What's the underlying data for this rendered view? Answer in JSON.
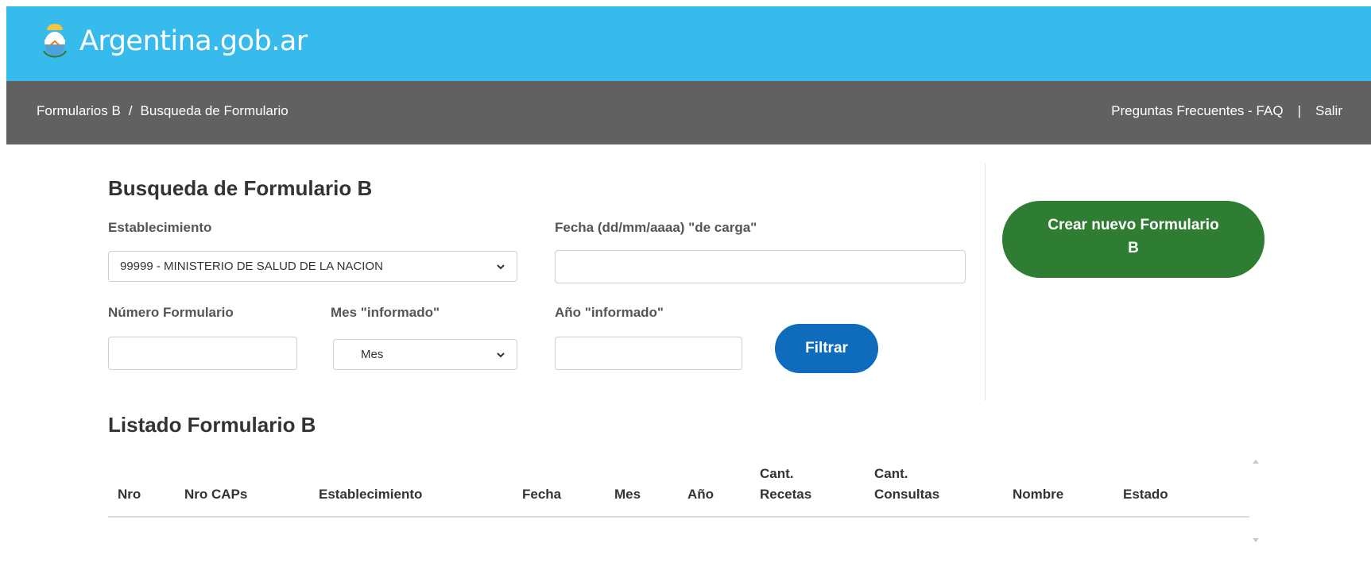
{
  "header": {
    "brand": "Argentina.gob.ar",
    "logo_icon": "argentina-coat-of-arms-icon",
    "bg_color": "#37bbed"
  },
  "nav": {
    "breadcrumb_root": "Formularios B",
    "breadcrumb_sep": "/",
    "breadcrumb_current": "Busqueda de Formulario",
    "faq": "Preguntas Frecuentes - FAQ",
    "pipe": "|",
    "logout": "Salir",
    "bg_color": "#616161"
  },
  "search": {
    "title": "Busqueda de Formulario B",
    "establecimiento_label": "Establecimiento",
    "establecimiento_value": "99999 - MINISTERIO DE SALUD DE LA NACION",
    "fecha_label": "Fecha (dd/mm/aaaa) \"de carga\"",
    "fecha_value": "",
    "numero_label": "Número Formulario",
    "numero_value": "",
    "mes_label": "Mes \"informado\"",
    "mes_value": "Mes",
    "anio_label": "Año \"informado\"",
    "anio_value": "",
    "filter_button": "Filtrar",
    "filter_color": "#0f6cbd"
  },
  "create_button": {
    "line1": "Crear nuevo Formulario",
    "line2": "B",
    "color": "#2e7d32"
  },
  "listado": {
    "title": "Listado Formulario B",
    "columns": {
      "nro": "Nro",
      "nro_caps": "Nro CAPs",
      "establecimiento": "Establecimiento",
      "fecha": "Fecha",
      "mes": "Mes",
      "anio": "Año",
      "recetas_1": "Cant.",
      "recetas_2": "Recetas",
      "consultas_1": "Cant.",
      "consultas_2": "Consultas",
      "nombre": "Nombre",
      "estado": "Estado"
    },
    "rows": []
  }
}
